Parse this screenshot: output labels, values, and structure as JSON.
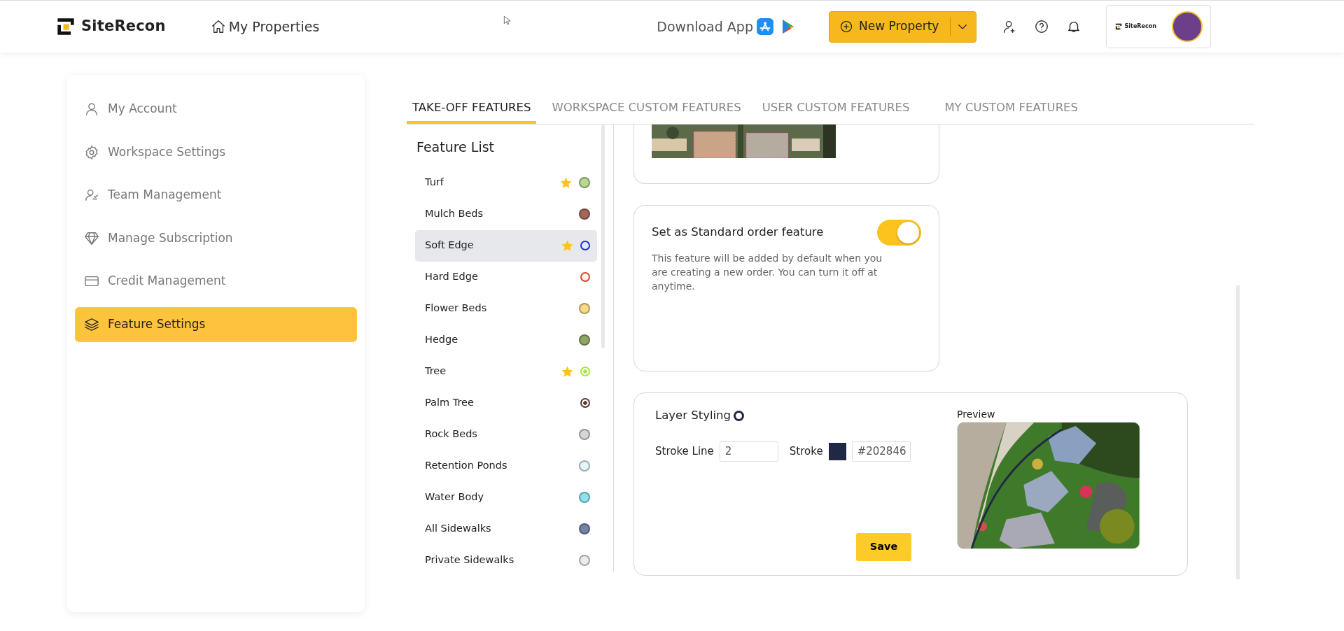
{
  "header": {
    "logo": "SiteRecon",
    "nav_link": "My Properties",
    "download_label": "Download App",
    "new_property_button": "New Property",
    "profile_logo": "SiteRecon"
  },
  "sidebar": {
    "items": [
      {
        "label": "My Account",
        "kind": "user",
        "selected": false
      },
      {
        "label": "Workspace Settings",
        "kind": "gear",
        "selected": false
      },
      {
        "label": "Team Management",
        "kind": "team",
        "selected": false
      },
      {
        "label": "Manage Subscription",
        "kind": "diamond",
        "selected": false
      },
      {
        "label": "Credit Management",
        "kind": "card",
        "selected": false
      },
      {
        "label": "Feature Settings",
        "kind": "layers",
        "selected": true
      }
    ]
  },
  "tabs": [
    {
      "label": "TAKE-OFF FEATURES",
      "selected": true
    },
    {
      "label": "WORKSPACE CUSTOM FEATURES",
      "selected": false
    },
    {
      "label": "USER CUSTOM FEATURES",
      "selected": false
    },
    {
      "label": "MY CUSTOM FEATURES",
      "selected": false
    }
  ],
  "feature_list": {
    "title": "Feature List",
    "items": [
      {
        "label": "Turf",
        "starred": true,
        "kind": "filled",
        "color": "#b9d88f",
        "selected": false
      },
      {
        "label": "Mulch Beds",
        "starred": false,
        "kind": "filled",
        "color": "#a0675a",
        "selected": false
      },
      {
        "label": "Soft Edge",
        "starred": true,
        "kind": "ring",
        "color": "#1432f0",
        "selected": true
      },
      {
        "label": "Hard Edge",
        "starred": false,
        "kind": "ring",
        "color": "#e2431a",
        "selected": false
      },
      {
        "label": "Flower Beds",
        "starred": false,
        "kind": "filled",
        "color": "#fbd98a",
        "selected": false
      },
      {
        "label": "Hedge",
        "starred": false,
        "kind": "filled",
        "color": "#8fa566",
        "selected": false
      },
      {
        "label": "Tree",
        "starred": true,
        "kind": "target",
        "color": "#a6e83a",
        "selected": false
      },
      {
        "label": "Palm Tree",
        "starred": false,
        "kind": "target",
        "color": "#5a3a30",
        "selected": false
      },
      {
        "label": "Rock Beds",
        "starred": false,
        "kind": "filled",
        "color": "#d6d6d6",
        "selected": false
      },
      {
        "label": "Retention Ponds",
        "starred": false,
        "kind": "filled",
        "color": "#e4f7fb",
        "selected": false
      },
      {
        "label": "Water Body",
        "starred": false,
        "kind": "filled",
        "color": "#8fe1f1",
        "selected": false
      },
      {
        "label": "All Sidewalks",
        "starred": false,
        "kind": "filled",
        "color": "#7383a5",
        "selected": false
      },
      {
        "label": "Private Sidewalks",
        "starred": false,
        "kind": "filled",
        "color": "#ececec",
        "selected": false
      }
    ]
  },
  "standard_order": {
    "title": "Set as Standard order feature",
    "on": true,
    "description": "This feature will be added by default when you are creating a new order. You can turn it off at anytime."
  },
  "layer_styling": {
    "title": "Layer Styling",
    "stroke_line_label": "Stroke Line",
    "stroke_line_value": "2",
    "stroke_label": "Stroke",
    "stroke_hex": "#202846",
    "preview_label": "Preview",
    "save_button": "Save"
  }
}
